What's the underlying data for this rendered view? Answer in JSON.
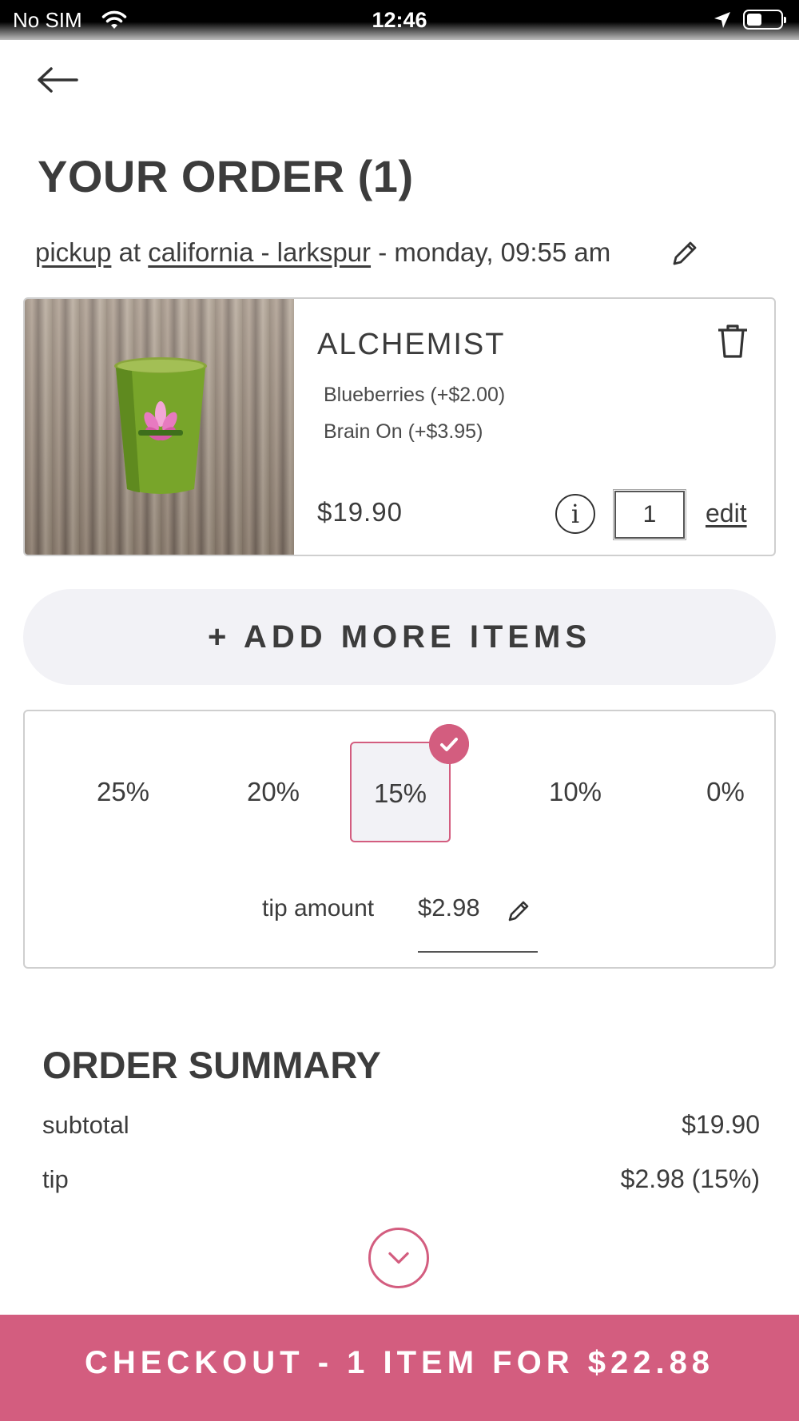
{
  "status_bar": {
    "carrier": "No SIM",
    "time": "12:46"
  },
  "header": {
    "title": "YOUR ORDER (1)"
  },
  "order_info": {
    "mode": "pickup",
    "at": "at",
    "location": "california - larkspur",
    "when": "- monday, 09:55 am"
  },
  "item": {
    "name": "ALCHEMIST",
    "modifiers": [
      "Blueberries (+$2.00)",
      "Brain On (+$3.95)"
    ],
    "price": "$19.90",
    "info_icon": "i",
    "quantity": "1",
    "edit_label": "edit"
  },
  "add_more": {
    "label": "+ ADD MORE ITEMS"
  },
  "tip": {
    "options": [
      "25%",
      "20%",
      "15%",
      "10%",
      "0%"
    ],
    "selected": "15%",
    "amount_label": "tip amount",
    "amount_value": "$2.98"
  },
  "summary": {
    "title": "ORDER SUMMARY",
    "rows": [
      {
        "label": "subtotal",
        "value": "$19.90"
      },
      {
        "label": "tip",
        "value": "$2.98 (15%)"
      }
    ]
  },
  "checkout": {
    "label": "CHECKOUT - 1 ITEM FOR $22.88"
  },
  "colors": {
    "accent": "#d35d7f",
    "text": "#3c3c3c",
    "button_bg": "#f2f2f6"
  },
  "icons": [
    "wifi-icon",
    "location-arrow-icon",
    "battery-icon",
    "back-arrow-icon",
    "pencil-icon",
    "trash-icon",
    "info-icon",
    "check-icon",
    "chevron-down-icon"
  ]
}
